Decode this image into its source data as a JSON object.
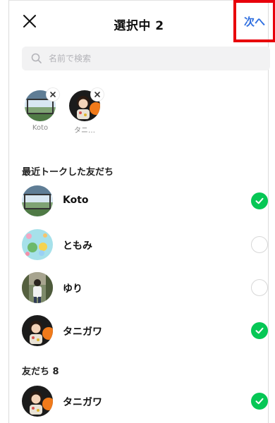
{
  "header": {
    "title": "選択中 2",
    "next_label": "次へ"
  },
  "search": {
    "placeholder": "名前で検索"
  },
  "selected": [
    {
      "label": "Koto"
    },
    {
      "label": "タニ…"
    }
  ],
  "sections": {
    "recent": "最近トークした友だち",
    "friends": "友だち 8"
  },
  "recent_list": [
    {
      "name": "Koto",
      "checked": true
    },
    {
      "name": "ともみ",
      "checked": false
    },
    {
      "name": "ゆり",
      "checked": false
    },
    {
      "name": "タニガワ",
      "checked": true
    }
  ],
  "friends_list": [
    {
      "name": "タニガワ",
      "checked": true
    }
  ],
  "colors": {
    "accent_blue": "#2f6fe0",
    "check_green": "#06c755",
    "highlight_red": "#e8000b"
  },
  "icons": {
    "close": "close-icon",
    "search": "search-icon",
    "remove": "remove-chip-icon",
    "check": "checkmark-icon"
  }
}
